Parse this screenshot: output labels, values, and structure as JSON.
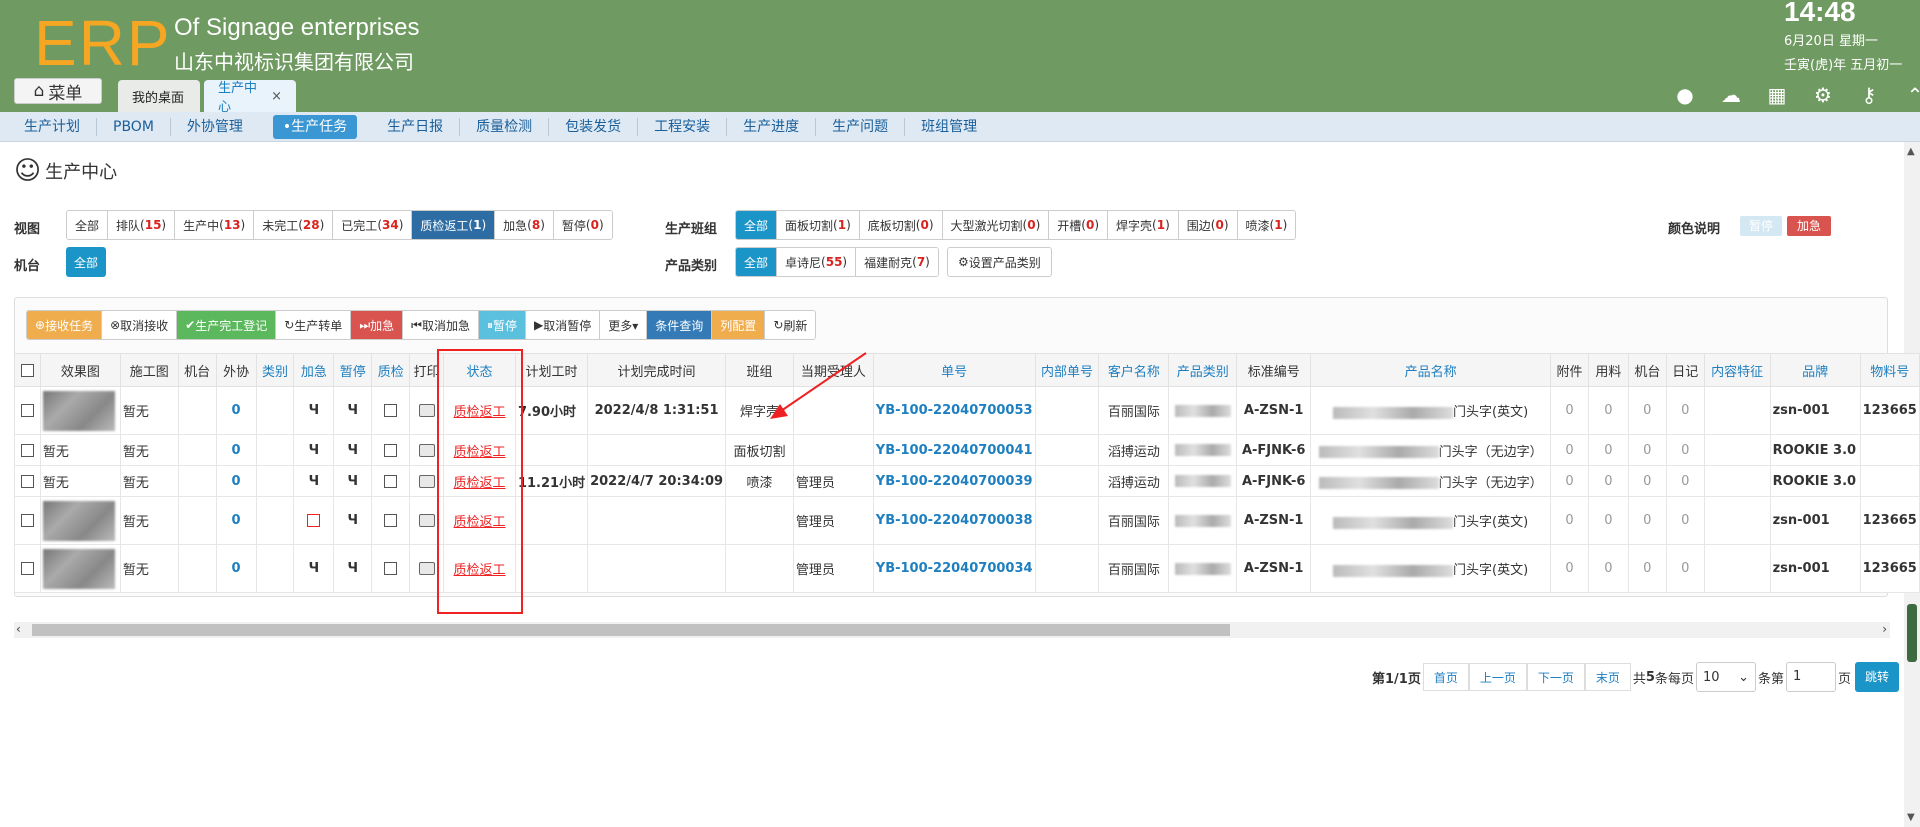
{
  "header": {
    "logo": "ERP",
    "company_en": "Of Signage enterprises",
    "company_cn": "山东中视标识集团有限公司",
    "time": "14:48",
    "date": "6月20日 星期一",
    "lunar": "壬寅(虎)年 五月初一",
    "menu_label": "菜单"
  },
  "tabs": [
    {
      "label": "我的桌面"
    },
    {
      "label": "生产中心",
      "close": "×"
    }
  ],
  "nav": [
    "生产计划",
    "PBOM",
    "外协管理",
    "•生产任务",
    "生产日报",
    "质量检测",
    "包装发货",
    "工程安装",
    "生产进度",
    "生产问题",
    "班组管理"
  ],
  "page": {
    "title": "生产中心"
  },
  "filters": {
    "view_label": "视图",
    "view": [
      {
        "t": "全部",
        "c": ""
      },
      {
        "t": "排队",
        "c": "15"
      },
      {
        "t": "生产中",
        "c": "13"
      },
      {
        "t": "未完工",
        "c": "28"
      },
      {
        "t": "已完工",
        "c": "34"
      },
      {
        "t": "质检返工",
        "c": "1"
      },
      {
        "t": "加急",
        "c": "8"
      },
      {
        "t": "暂停",
        "c": "0"
      }
    ],
    "machine_label": "机台",
    "machine_all": "全部",
    "team_label": "生产班组",
    "team": [
      {
        "t": "全部",
        "c": ""
      },
      {
        "t": "面板切割",
        "c": "1"
      },
      {
        "t": "底板切割",
        "c": "0"
      },
      {
        "t": "大型激光切割",
        "c": "0"
      },
      {
        "t": "开槽",
        "c": "0"
      },
      {
        "t": "焊字壳",
        "c": "1"
      },
      {
        "t": "围边",
        "c": "0"
      },
      {
        "t": "喷漆",
        "c": "1"
      }
    ],
    "ptype_label": "产品类别",
    "ptype": [
      {
        "t": "全部",
        "c": ""
      },
      {
        "t": "卓诗尼",
        "c": "55"
      },
      {
        "t": "福建耐克",
        "c": "7"
      }
    ],
    "set_ptype": "设置产品类别",
    "color_label": "颜色说明",
    "color_pause": "暂停",
    "color_urgent": "加急",
    "legend_colors": {
      "pause": "#d3e8f3",
      "urgent": "#d9534f"
    }
  },
  "toolbar": [
    "接收任务",
    "取消接收",
    "生产完工登记",
    "生产转单",
    "加急",
    "取消加急",
    "暂停",
    "取消暂停",
    "更多▾",
    "条件查询",
    "列配置",
    "刷新"
  ],
  "table": {
    "headers": [
      "效果图",
      "施工图",
      "机台",
      "外协",
      "类别",
      "加急",
      "暂停",
      "质检",
      "打印",
      "状态",
      "计划工时",
      "计划完成时间",
      "班组",
      "当期受理人",
      "单号",
      "内部单号",
      "客户名称",
      "产品类别",
      "标准编号",
      "产品名称",
      "附件",
      "用料",
      "机台",
      "日记",
      "内容特征",
      "品牌",
      "物料号"
    ],
    "rows": [
      {
        "img": true,
        "sg": "暂无",
        "wx": "0",
        "jj": "Ч",
        "zt": "Ч",
        "zj": "",
        "zjred": false,
        "status": "质检返工",
        "hours": "7.90小时",
        "due": "2022/4/8 1:31:51",
        "team": "焊字壳",
        "person": "",
        "no": "YB-100-22040700053",
        "cust": "百丽国际",
        "std": "A-ZSN-1",
        "pname": "门头字(英文)",
        "fj": "0",
        "yl": "0",
        "jt": "0",
        "rj": "0",
        "brand": "zsn-001",
        "mat": "123665"
      },
      {
        "img": false,
        "xg": "暂无",
        "sg": "暂无",
        "wx": "0",
        "jj": "Ч",
        "zt": "Ч",
        "zj": "",
        "zjred": false,
        "status": "质检返工",
        "hours": "",
        "due": "",
        "team": "面板切割",
        "person": "",
        "no": "YB-100-22040700041",
        "cust": "滔搏运动",
        "std": "A-FJNK-6",
        "pname": "门头字（无边字）",
        "fj": "0",
        "yl": "0",
        "jt": "0",
        "rj": "0",
        "brand": "ROOKIE 3.0",
        "mat": ""
      },
      {
        "img": false,
        "xg": "暂无",
        "sg": "暂无",
        "wx": "0",
        "jj": "Ч",
        "zt": "Ч",
        "zj": "",
        "zjred": false,
        "status": "质检返工",
        "hours": "11.21小时",
        "due": "2022/4/7 20:34:09",
        "team": "喷漆",
        "person": "管理员",
        "no": "YB-100-22040700039",
        "cust": "滔搏运动",
        "std": "A-FJNK-6",
        "pname": "门头字（无边字）",
        "fj": "0",
        "yl": "0",
        "jt": "0",
        "rj": "0",
        "brand": "ROOKIE 3.0",
        "mat": ""
      },
      {
        "img": true,
        "sg": "暂无",
        "wx": "0",
        "jj": "",
        "zt": "Ч",
        "zj": "",
        "zjred": true,
        "status": "质检返工",
        "hours": "",
        "due": "",
        "team": "",
        "person": "管理员",
        "no": "YB-100-22040700038",
        "cust": "百丽国际",
        "std": "A-ZSN-1",
        "pname": "门头字(英文)",
        "fj": "0",
        "yl": "0",
        "jt": "0",
        "rj": "0",
        "brand": "zsn-001",
        "mat": "123665"
      },
      {
        "img": true,
        "sg": "暂无",
        "wx": "0",
        "jj": "Ч",
        "zt": "Ч",
        "zj": "",
        "zjred": false,
        "status": "质检返工",
        "hours": "",
        "due": "",
        "team": "",
        "person": "管理员",
        "no": "YB-100-22040700034",
        "cust": "百丽国际",
        "std": "A-ZSN-1",
        "pname": "门头字(英文)",
        "fj": "0",
        "yl": "0",
        "jt": "0",
        "rj": "0",
        "brand": "zsn-001",
        "mat": "123665"
      }
    ]
  },
  "pager": {
    "page_info": "第1/1页",
    "first": "首页",
    "prev": "上一页",
    "next": "下一页",
    "last": "末页",
    "total_pre": "共",
    "total": "5",
    "total_post": "条每页",
    "per_page": "10",
    "jump_pre": "条第",
    "jump_val": "1",
    "jump_post": "页",
    "go": "跳转"
  }
}
